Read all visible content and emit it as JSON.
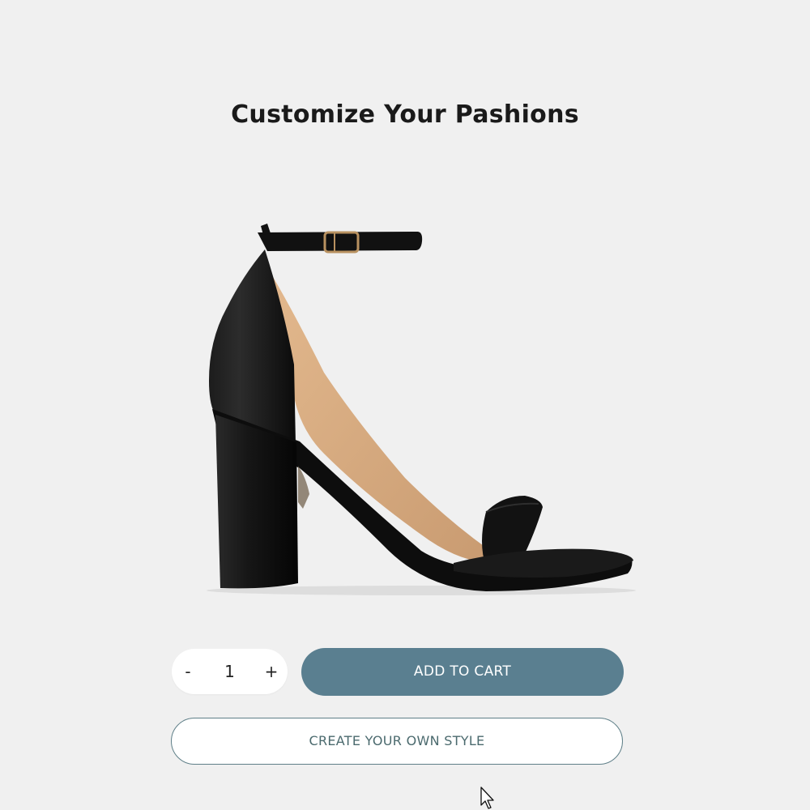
{
  "page": {
    "title": "Customize Your Pashions"
  },
  "product": {
    "image_icon": "block-heel-sandal-image",
    "color": "#111111"
  },
  "quantity": {
    "minus_label": "-",
    "value": "1",
    "plus_label": "+"
  },
  "actions": {
    "add_to_cart_label": "ADD TO CART",
    "create_style_label": "CREATE YOUR OWN STYLE"
  },
  "colors": {
    "accent": "#5a7f90",
    "outline": "#5f7f88",
    "background": "#f0f0f0"
  }
}
